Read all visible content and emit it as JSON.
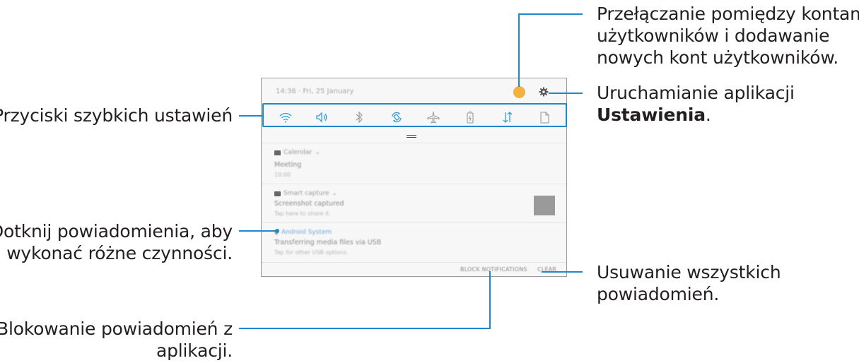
{
  "callouts": {
    "accounts": [
      "Przełączanie pomiędzy kontami",
      "użytkowników i dodawanie",
      "nowych kont użytkowników."
    ],
    "settings_line1": "Uruchamianie aplikacji",
    "settings_bold": "Ustawienia",
    "settings_suffix": ".",
    "quick_settings": "Przyciski szybkich ustawień",
    "notification_tap": [
      "Dotknij powiadomienia, aby",
      "wykonać różne czynności."
    ],
    "clear_all": [
      "Usuwanie wszystkich",
      "powiadomień."
    ],
    "block": [
      "Blokowanie powiadomień z",
      "aplikacji."
    ]
  },
  "panel": {
    "status_text": "14:36 · Fri, 25 January",
    "quick_settings_icons": [
      "wifi-icon",
      "sound-icon",
      "bluetooth-icon",
      "auto-rotate-icon",
      "airplane-mode-icon",
      "flashlight-icon",
      "mobile-data-icon",
      "more-icon"
    ],
    "notifications": [
      {
        "app": "Calendar",
        "title": "Meeting",
        "subtitle": "10:00"
      },
      {
        "app": "Smart capture",
        "title": "Screenshot captured",
        "subtitle": "Tap here to share it."
      },
      {
        "app": "Android System",
        "title": "Transferring media files via USB",
        "subtitle": "Tap for other USB options."
      }
    ],
    "footer": {
      "block_label": "BLOCK NOTIFICATIONS",
      "clear_label": "CLEAR"
    }
  },
  "colors": {
    "accent": "#1e88c8",
    "avatar": "#f3b23d",
    "text": "#231f20"
  }
}
